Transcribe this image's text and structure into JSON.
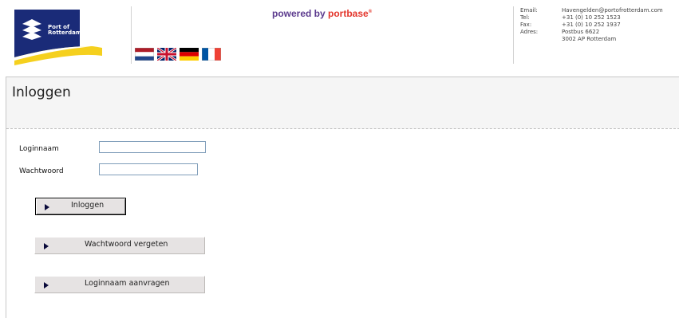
{
  "header": {
    "logo": {
      "line1": "Port of",
      "line2": "Rotterdam",
      "colors": {
        "navy": "#1a2b78",
        "yellow": "#f5d01e"
      }
    },
    "powered": {
      "prefix": "powered by ",
      "brand": "portbase",
      "mark": "®"
    },
    "languages": [
      {
        "code": "nl",
        "icon": "dutch-flag-icon"
      },
      {
        "code": "en",
        "icon": "uk-flag-icon"
      },
      {
        "code": "de",
        "icon": "german-flag-icon"
      },
      {
        "code": "fr",
        "icon": "french-flag-icon"
      }
    ],
    "contact": {
      "email_label": "Email:",
      "email": "Havengelden@portofrotterdam.com",
      "tel_label": "Tel:",
      "tel": "+31 (0) 10 252 1523",
      "fax_label": "Fax:",
      "fax": "+31 (0) 10 252 1937",
      "address_label": "Adres:",
      "address_line1": "Postbus 6622",
      "address_line2": "3002 AP  Rotterdam"
    }
  },
  "main": {
    "title": "Inloggen",
    "username_label": "Loginnaam",
    "username_value": "",
    "password_label": "Wachtwoord",
    "password_value": "",
    "buttons": {
      "login": "Inloggen",
      "forgot": "Wachtwoord vergeten",
      "request": "Loginnaam aanvragen"
    }
  }
}
